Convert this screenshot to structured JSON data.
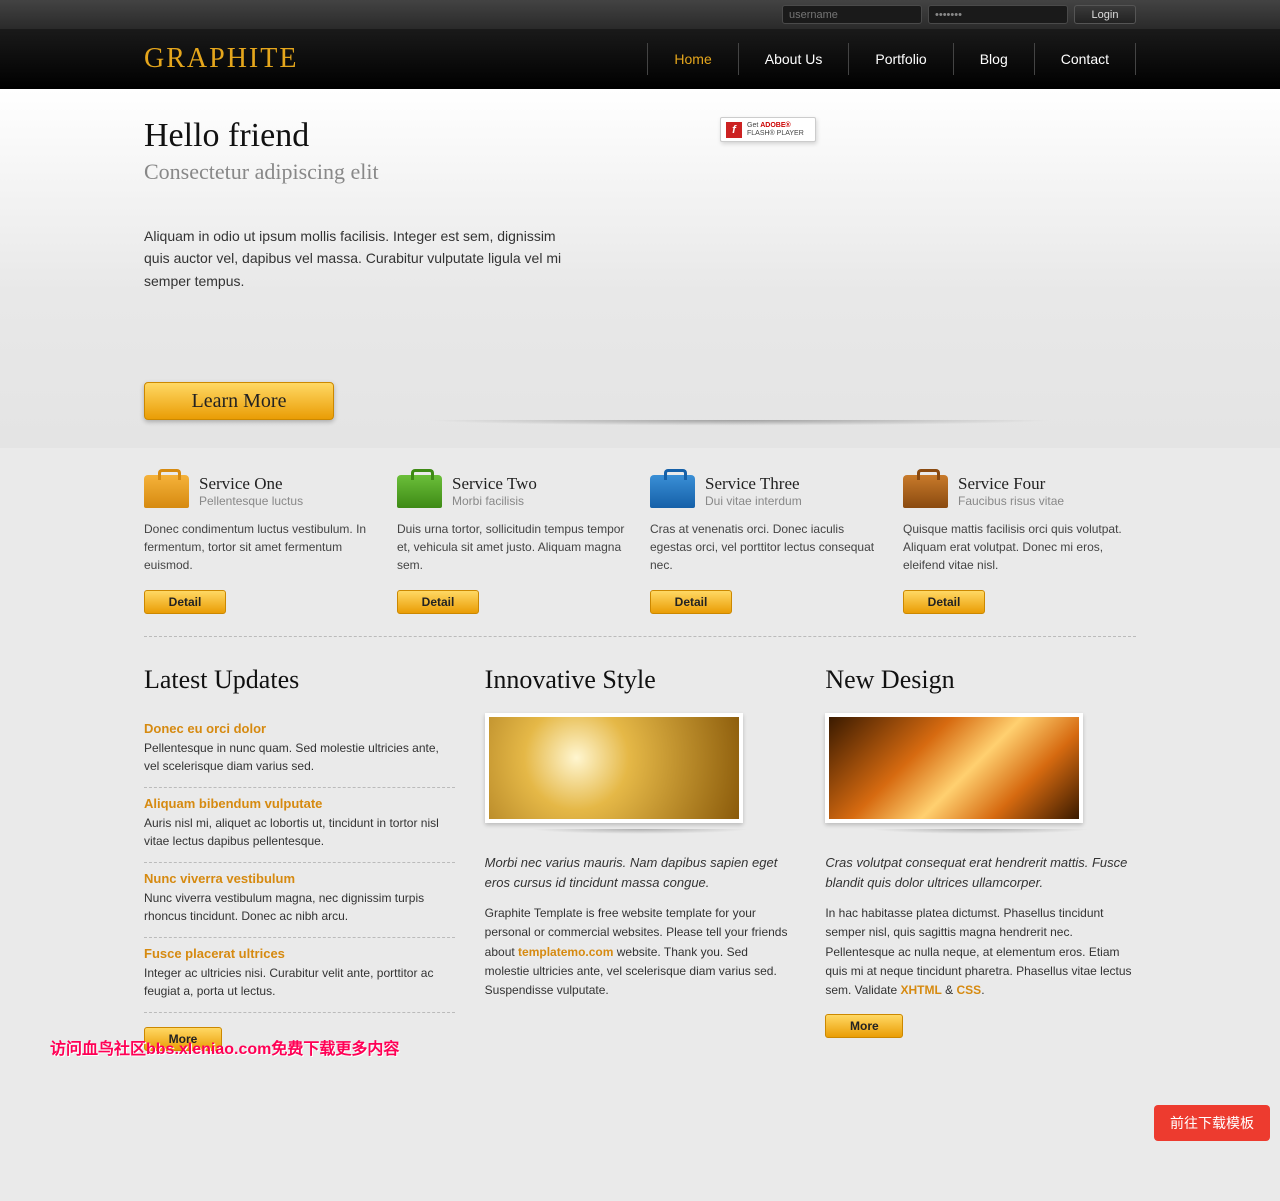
{
  "topbar": {
    "username_placeholder": "username",
    "password_value": "•••••••",
    "login_label": "Login"
  },
  "brand": "GRAPHITE",
  "nav": [
    "Home",
    "About Us",
    "Portfolio",
    "Blog",
    "Contact"
  ],
  "hero": {
    "title": "Hello friend",
    "subtitle": "Consectetur adipiscing elit",
    "body": "Aliquam in odio ut ipsum mollis facilisis. Integer est sem, dignissim quis auctor vel, dapibus vel massa. Curabitur vulputate ligula vel mi semper tempus.",
    "learn_more": "Learn More"
  },
  "flash": {
    "prefix": "Get ",
    "brand": "ADOBE®",
    "line2": "FLASH® PLAYER"
  },
  "services": [
    {
      "title": "Service One",
      "sub": "Pellentesque luctus",
      "text": "Donec condimentum luctus vestibulum. In fermentum, tortor sit amet fermentum euismod.",
      "btn": "Detail",
      "iconClass": "bc-orange"
    },
    {
      "title": "Service Two",
      "sub": "Morbi facilisis",
      "text": "Duis urna tortor, sollicitudin tempus tempor et, vehicula sit amet justo. Aliquam magna sem.",
      "btn": "Detail",
      "iconClass": "bc-green"
    },
    {
      "title": "Service Three",
      "sub": "Dui vitae interdum",
      "text": "Cras at venenatis orci. Donec iaculis egestas orci, vel porttitor lectus consequat nec.",
      "btn": "Detail",
      "iconClass": "bc-blue"
    },
    {
      "title": "Service Four",
      "sub": "Faucibus risus vitae",
      "text": "Quisque mattis facilisis orci quis volutpat. Aliquam erat volutpat. Donec mi eros, eleifend vitae nisl.",
      "btn": "Detail",
      "iconClass": "bc-brown"
    }
  ],
  "updates": {
    "heading": "Latest Updates",
    "items": [
      {
        "title": "Donec eu orci dolor",
        "text": "Pellentesque in nunc quam. Sed molestie ultricies ante, vel scelerisque diam varius sed."
      },
      {
        "title": "Aliquam bibendum vulputate",
        "text": "Auris nisl mi, aliquet ac lobortis ut, tincidunt in tortor nisl vitae lectus dapibus pellentesque."
      },
      {
        "title": "Nunc viverra vestibulum",
        "text": "Nunc viverra vestibulum magna, nec dignissim turpis rhoncus tincidunt. Donec ac nibh arcu."
      },
      {
        "title": "Fusce placerat ultrices",
        "text": "Integer ac ultricies nisi. Curabitur velit ante, porttitor ac feugiat a, porta ut lectus."
      }
    ],
    "more": "More"
  },
  "col2": {
    "heading": "Innovative Style",
    "lead": "Morbi nec varius mauris. Nam dapibus sapien eget eros cursus id tincidunt massa congue.",
    "body_pre": "Graphite Template is free website template for your personal or commercial websites. Please tell your friends about ",
    "body_link": "templatemo.com",
    "body_post": " website. Thank you. Sed molestie ultricies ante, vel scelerisque diam varius sed. Suspendisse vulputate."
  },
  "col3": {
    "heading": "New Design",
    "lead": "Cras volutpat consequat erat hendrerit mattis. Fusce blandit quis dolor ultrices ullamcorper.",
    "body_pre": "In hac habitasse platea dictumst. Phasellus tincidunt semper nisl, quis sagittis magna hendrerit nec. Pellentesque ac nulla neque, at elementum eros. Etiam quis mi at neque tincidunt pharetra. Phasellus vitae lectus sem. Validate ",
    "xhtml": "XHTML",
    "amp": " & ",
    "css": "CSS",
    "period": ".",
    "more": "More"
  },
  "float_button": "前往下载模板",
  "overlay": "访问血鸟社区bbs.xleniao.com免费下载更多内容"
}
